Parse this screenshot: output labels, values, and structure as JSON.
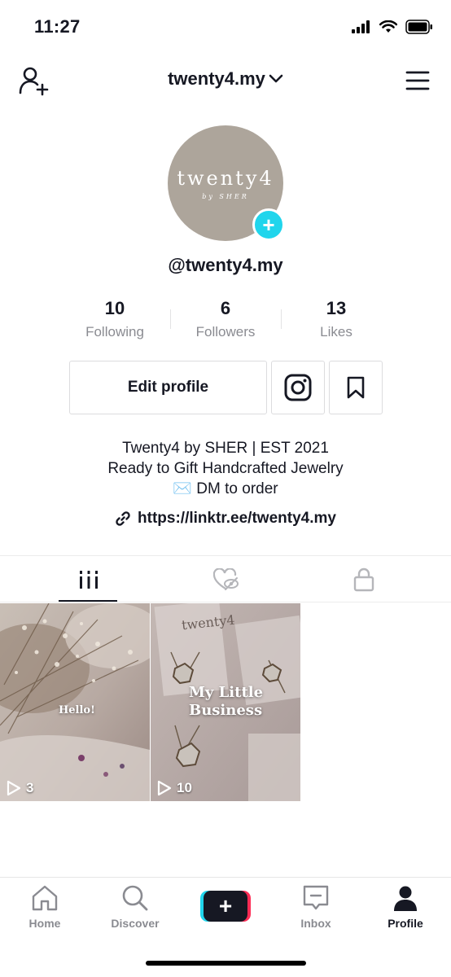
{
  "status": {
    "time": "11:27"
  },
  "header": {
    "username": "twenty4.my",
    "add_user_icon": "add-user-icon",
    "menu_icon": "menu-icon",
    "dropdown_icon": "chevron-down-icon"
  },
  "avatar": {
    "brand": "twenty4",
    "sub": "by SHER",
    "plus": "+"
  },
  "profile": {
    "handle": "@twenty4.my"
  },
  "stats": [
    {
      "value": "10",
      "label": "Following"
    },
    {
      "value": "6",
      "label": "Followers"
    },
    {
      "value": "13",
      "label": "Likes"
    }
  ],
  "actions": {
    "edit_label": "Edit profile"
  },
  "bio": {
    "line1": "Twenty4 by SHER | EST 2021",
    "line2": "Ready to Gift Handcrafted Jewelry",
    "line3": "✉️ DM to order",
    "link": "https://linktr.ee/twenty4.my"
  },
  "videos": [
    {
      "caption": "Hello!",
      "plays": "3"
    },
    {
      "caption": "My Little Business",
      "plays": "10",
      "brand": "twenty4"
    }
  ],
  "nav": {
    "home": "Home",
    "discover": "Discover",
    "create": "+",
    "inbox": "Inbox",
    "profile": "Profile"
  },
  "colors": {
    "accent_cyan": "#20d5ec",
    "accent_red": "#fe2c55",
    "text": "#161823",
    "muted": "#8a8b91"
  }
}
